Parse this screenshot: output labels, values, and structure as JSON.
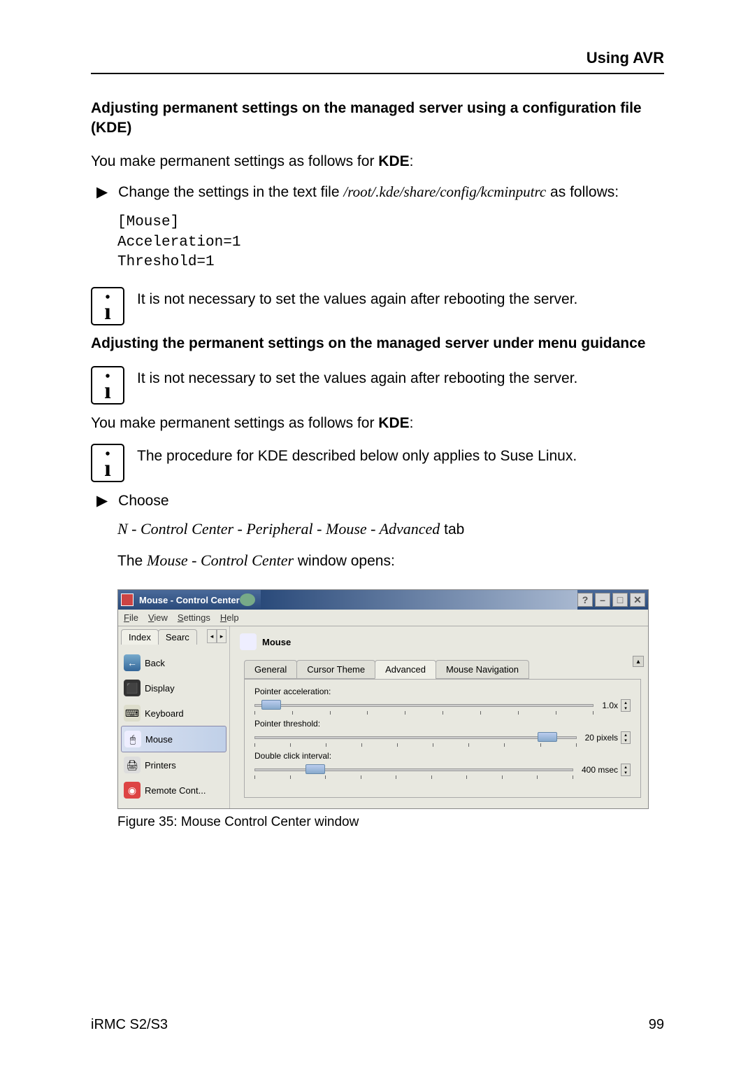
{
  "header": {
    "title": "Using AVR"
  },
  "section1": {
    "heading": "Adjusting permanent settings on the managed server using a configuration file (KDE)",
    "intro_part1": "You make permanent settings as follows for ",
    "intro_bold": "KDE",
    "intro_part2": ":",
    "bullet1_part1": "Change the settings in the text file ",
    "bullet1_path": "/root/.kde/share/config/kcminputrc",
    "bullet1_part2": " as follows:",
    "code_line1": "[Mouse]",
    "code_line2": "Acceleration=1",
    "code_line3": "Threshold=1",
    "info1": "It is not necessary to set the values again after rebooting the server."
  },
  "section2": {
    "heading": "Adjusting the permanent settings on the managed server under menu guidance",
    "info1": "It is not necessary to set the values again after rebooting the server.",
    "intro_part1": "You make permanent settings as follows for ",
    "intro_bold": "KDE",
    "intro_part2": ":",
    "info2": "The procedure for KDE described below only applies to Suse Linux.",
    "bullet1": "Choose",
    "nav_path": "N - Control Center - Peripheral - Mouse - Advanced",
    "nav_suffix": " tab",
    "window_opens_part1": "The ",
    "window_opens_italic": "Mouse - Control Center",
    "window_opens_part2": " window opens:"
  },
  "screenshot": {
    "title": "Mouse - Control Center",
    "menu": {
      "file": "File",
      "view": "View",
      "settings": "Settings",
      "help": "Help"
    },
    "sidebar": {
      "tab_index": "Index",
      "tab_search": "Searc",
      "items": {
        "back": "Back",
        "display": "Display",
        "keyboard": "Keyboard",
        "mouse": "Mouse",
        "printers": "Printers",
        "remote": "Remote Cont..."
      }
    },
    "main": {
      "heading": "Mouse",
      "tabs": {
        "general": "General",
        "cursor": "Cursor Theme",
        "advanced": "Advanced",
        "nav": "Mouse Navigation"
      },
      "sliders": {
        "accel_label": "Pointer acceleration:",
        "accel_value": "1.0x",
        "threshold_label": "Pointer threshold:",
        "threshold_value": "20 pixels",
        "dclick_label": "Double click interval:",
        "dclick_value": "400 msec"
      }
    }
  },
  "figure_caption": "Figure 35: Mouse Control Center window",
  "footer": {
    "left": "iRMC S2/S3",
    "right": "99"
  }
}
